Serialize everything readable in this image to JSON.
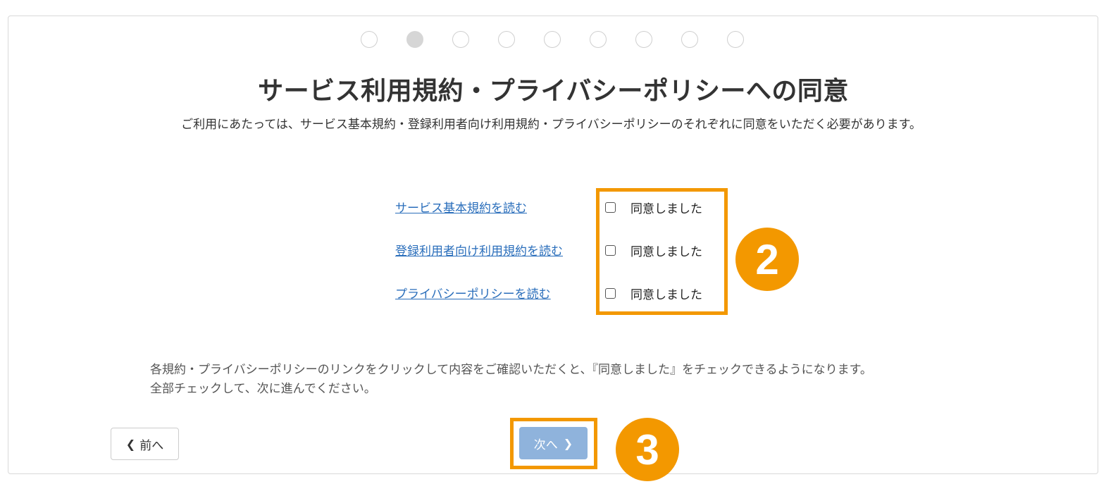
{
  "stepper": {
    "total_steps": 9,
    "current_step": 2
  },
  "page": {
    "title": "サービス利用規約・プライバシーポリシーへの同意",
    "subtitle": "ご利用にあたっては、サービス基本規約・登録利用者向け利用規約・プライバシーポリシーのそれぞれに同意をいただく必要があります。"
  },
  "agreements": [
    {
      "link_label": "サービス基本規約を読む",
      "checkbox_label": "同意しました",
      "checked": false
    },
    {
      "link_label": "登録利用者向け利用規約を読む",
      "checkbox_label": "同意しました",
      "checked": false
    },
    {
      "link_label": "プライバシーポリシーを読む",
      "checkbox_label": "同意しました",
      "checked": false
    }
  ],
  "note": {
    "line1": "各規約・プライバシーポリシーのリンクをクリックして内容をご確認いただくと、『同意しました』をチェックできるようになります。",
    "line2": "全部チェックして、次に進んでください。"
  },
  "buttons": {
    "prev_label": "前へ",
    "next_label": "次へ"
  },
  "annotations": {
    "badge_2": "2",
    "badge_3": "3",
    "highlight_color": "#f39800"
  },
  "colors": {
    "link": "#2a6ebb",
    "next_button": "#8fb3dc"
  }
}
